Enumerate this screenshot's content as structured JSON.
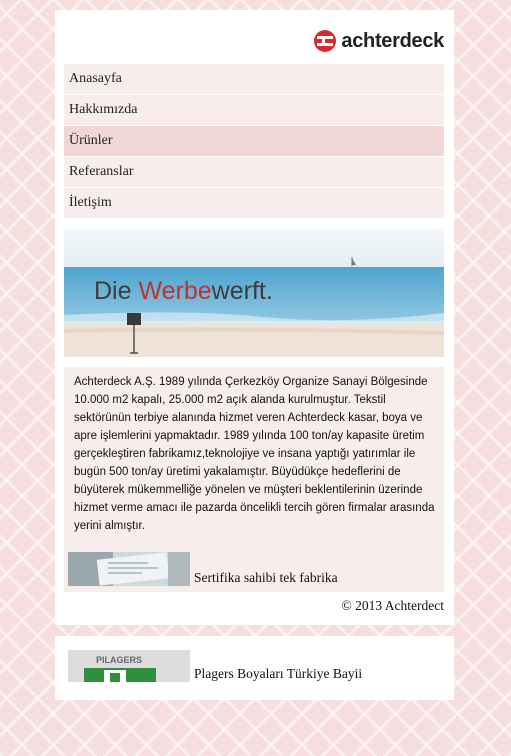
{
  "logo": {
    "text": "achterdeck",
    "icon": "achterdeck-logo-icon",
    "brand_color": "#d8292f"
  },
  "nav": {
    "items": [
      {
        "label": "Anasayfa"
      },
      {
        "label": "Hakkımızda"
      },
      {
        "label": "Ürünler"
      },
      {
        "label": "Referanslar"
      },
      {
        "label": "İletişim"
      }
    ],
    "active_index": 2
  },
  "banner": {
    "text_part1": "Die ",
    "text_part2": "Werbe",
    "text_part3": "werft."
  },
  "content": {
    "description": "Achterdeck A.Ş. 1989 yılında Çerkezköy Organize Sanayi Bölgesinde 10.000 m2 kapalı, 25.000 m2 açık alanda kurulmuştur. Tekstil sektörünün terbiye alanında hizmet veren Achterdeck kasar, boya ve apre işlemlerini yapmaktadır. 1989 yılında 100 ton/ay kapasite üretim gerçekleştiren fabrikamız,teknolojiye ve insana yaptığı yatırımlar ile bugün 500 ton/ay üretimi yakalamıştır. Büyüdükçe hedeflerini de büyüterek mükemmelliğe yönelen ve müşteri beklentilerinin üzerinde hizmet verme amacı ile pazarda öncelikli tercih gören firmalar arasında yerini almıştır.",
    "certificate_label": "Sertifika sahibi tek fabrika"
  },
  "footer": {
    "copyright": "©  2013 Achterdect"
  },
  "partner": {
    "logo_text": "PILAGERS",
    "label": "Plagers Boyaları Türkiye Bayii"
  }
}
